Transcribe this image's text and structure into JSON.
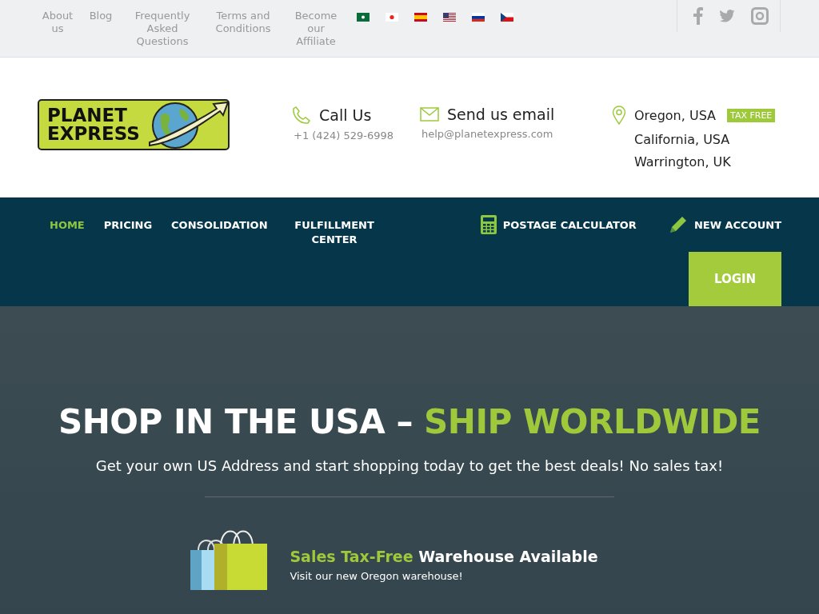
{
  "top_links": [
    "About us",
    "Blog",
    "Frequently Asked Questions",
    "Terms and Conditions",
    "Become our Affiliate"
  ],
  "logo": {
    "line1": "PLANET",
    "line2": "EXPRESS"
  },
  "contacts": [
    {
      "kind": "phone",
      "title": "Call Us",
      "detail": "+1 (424) 529-6998"
    },
    {
      "kind": "email",
      "title": "Send us email",
      "detail": "help@planetexpress.com"
    }
  ],
  "locations": [
    {
      "name": "Oregon, USA",
      "badge": "TAX FREE"
    },
    {
      "name": "California, USA"
    },
    {
      "name": "Warrington, UK"
    }
  ],
  "nav": [
    {
      "label": "HOME",
      "selected": true
    },
    {
      "label": "PRICING",
      "selected": false
    },
    {
      "label": "CONSOLIDATION",
      "selected": false
    },
    {
      "label": "FULFILLMENT CENTER",
      "selected": false
    }
  ],
  "nav_actions": [
    {
      "kind": "calculator",
      "label": "POSTAGE CALCULATOR"
    },
    {
      "kind": "pencil",
      "label": "NEW ACCOUNT"
    }
  ],
  "login": "LOGIN",
  "hero": {
    "title_plain": "SHOP IN THE USA –",
    "title_accent": "SHIP WORLDWIDE",
    "subtitle": "Get your own US Address and start shopping today to get the best deals! No sales tax!",
    "feature": {
      "accent": "Sales Tax-Free",
      "title": "Warehouse Available",
      "text": "Visit our new Oregon warehouse!"
    }
  }
}
